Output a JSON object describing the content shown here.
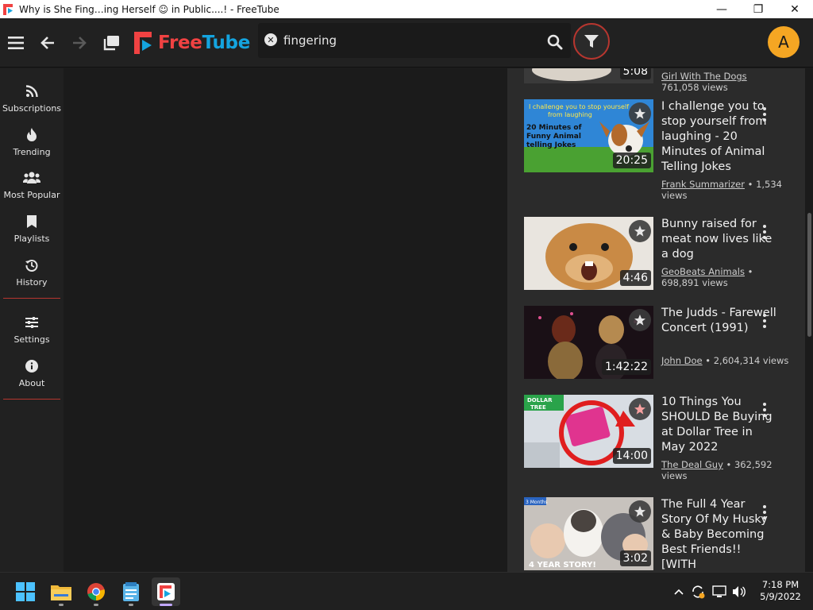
{
  "window": {
    "title": "Why is She Fing…ing Herself ☺ in Public....! - FreeTube",
    "minimize": "—",
    "maximize": "❐",
    "close": "✕"
  },
  "topnav": {
    "logo_free": "Free",
    "logo_tube": "Tube",
    "search_value": "fingering",
    "avatar_letter": "A"
  },
  "sidebar": {
    "items": [
      {
        "label": "Subscriptions",
        "icon": "rss-icon"
      },
      {
        "label": "Trending",
        "icon": "fire-icon"
      },
      {
        "label": "Most Popular",
        "icon": "users-icon"
      },
      {
        "label": "Playlists",
        "icon": "bookmark-icon"
      },
      {
        "label": "History",
        "icon": "history-icon"
      },
      {
        "label": "Settings",
        "icon": "sliders-icon"
      },
      {
        "label": "About",
        "icon": "info-icon"
      }
    ]
  },
  "videos": [
    {
      "title": "",
      "duration": "5:08",
      "channel": "Girl With The Dogs",
      "views": "761,058 views"
    },
    {
      "title": "I challenge you to stop yourself from laughing - 20 Minutes of Animal Telling Jokes",
      "duration": "20:25",
      "channel": "Frank Summarizer",
      "views": " • 1,534 views",
      "thumb_text": "I challenge you to stop yourself from laughing",
      "thumb_text2": "20 Minutes of Funny Animal telling Jokes"
    },
    {
      "title": "Bunny raised for meat now lives like a dog",
      "duration": "4:46",
      "channel": "GeoBeats Animals",
      "views": " • 698,891 views"
    },
    {
      "title": "The Judds - Farewell Concert (1991)",
      "duration": "1:42:22",
      "channel": "John Doe",
      "views": " • 2,604,314 views"
    },
    {
      "title": "10 Things You SHOULD Be Buying at Dollar Tree in May 2022",
      "duration": "14:00",
      "channel": "The Deal Guy",
      "views": " • 362,592 views",
      "thumb_text": "DOLLAR TREE"
    },
    {
      "title": "The Full 4 Year Story Of My Husky & Baby Becoming Best Friends!! [WITH",
      "duration": "3:02",
      "thumb_text": "4 YEAR STORY!",
      "thumb_badge": "3 Months"
    }
  ],
  "taskbar": {
    "time": "7:18 PM",
    "date": "5/9/2022"
  },
  "colors": {
    "accent_red": "#b7362f",
    "logo_red": "#f04242",
    "logo_blue": "#14a4df",
    "avatar": "#f5a623"
  }
}
